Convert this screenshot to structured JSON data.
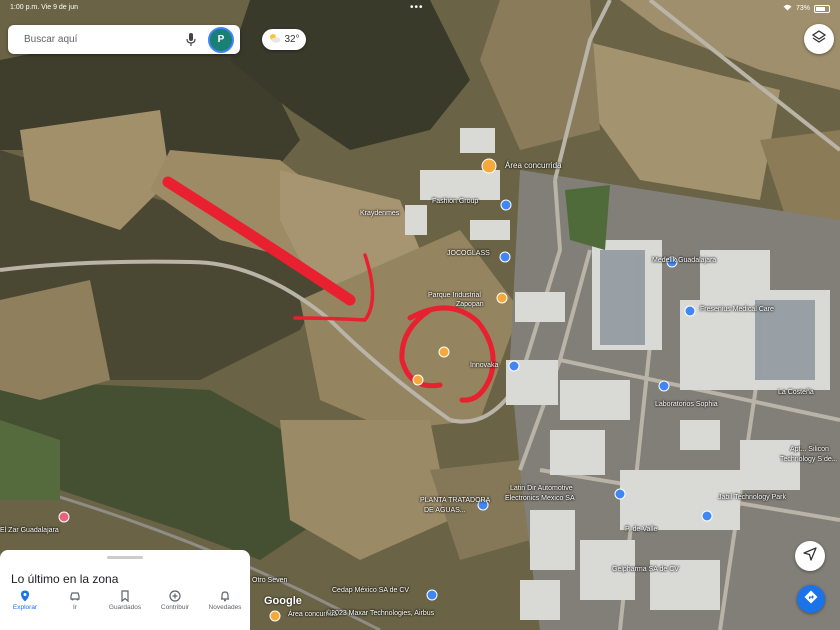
{
  "status_bar": {
    "time": "1:00 p.m.",
    "date": "Vie 9 de jun",
    "battery": "73%"
  },
  "search": {
    "placeholder": "Buscar aquí",
    "avatar_letter": "P"
  },
  "weather": {
    "temperature": "32°"
  },
  "bottom_sheet": {
    "title": "Lo último en la zona"
  },
  "bottom_nav": [
    {
      "label": "Explorar",
      "icon": "pin-icon"
    },
    {
      "label": "Ir",
      "icon": "car-icon"
    },
    {
      "label": "Guardados",
      "icon": "bookmark-icon"
    },
    {
      "label": "Contribuir",
      "icon": "plus-circle-icon"
    },
    {
      "label": "Novedades",
      "icon": "bell-icon"
    }
  ],
  "map_labels": {
    "area": "Área concurrida",
    "fashion": "Fashion Group",
    "kraydenmes": "Kraydenmes",
    "jocoglass": "JOCOGLASS",
    "parque1": "Parque Industrial",
    "parque2": "Zapopan",
    "innovaka": "Innovaka",
    "medelik": "Medelik Guadalajara",
    "fresenius": "Fresenius Medical Care",
    "sophia": "Laboratorios Sophia",
    "costena": "La Costeña",
    "jabil": "Jabil Technology Park",
    "planta1": "PLANTA TRATADORA",
    "planta2": "DE AGUAS...",
    "latin1": "Latin Dir Automotive",
    "latin2": "Electronics Mexico SA",
    "zar": "El Zar Guadalajara",
    "seven": "Otro Seven",
    "concurrida_low": "Área concurrida",
    "cedap": "Cedap México SA de CV",
    "gelpharma": "Gelpharma SA de CV",
    "apt1": "Apt... Silicon",
    "apt2": "Technology S de...",
    "vale": "P. de Valle",
    "copyright": "©2023 Maxar Technologies, Airbus",
    "google": "Google"
  },
  "colors": {
    "annotation": "#e8202f",
    "accent": "#1a73e8",
    "poi_orange": "#f4a93a"
  }
}
